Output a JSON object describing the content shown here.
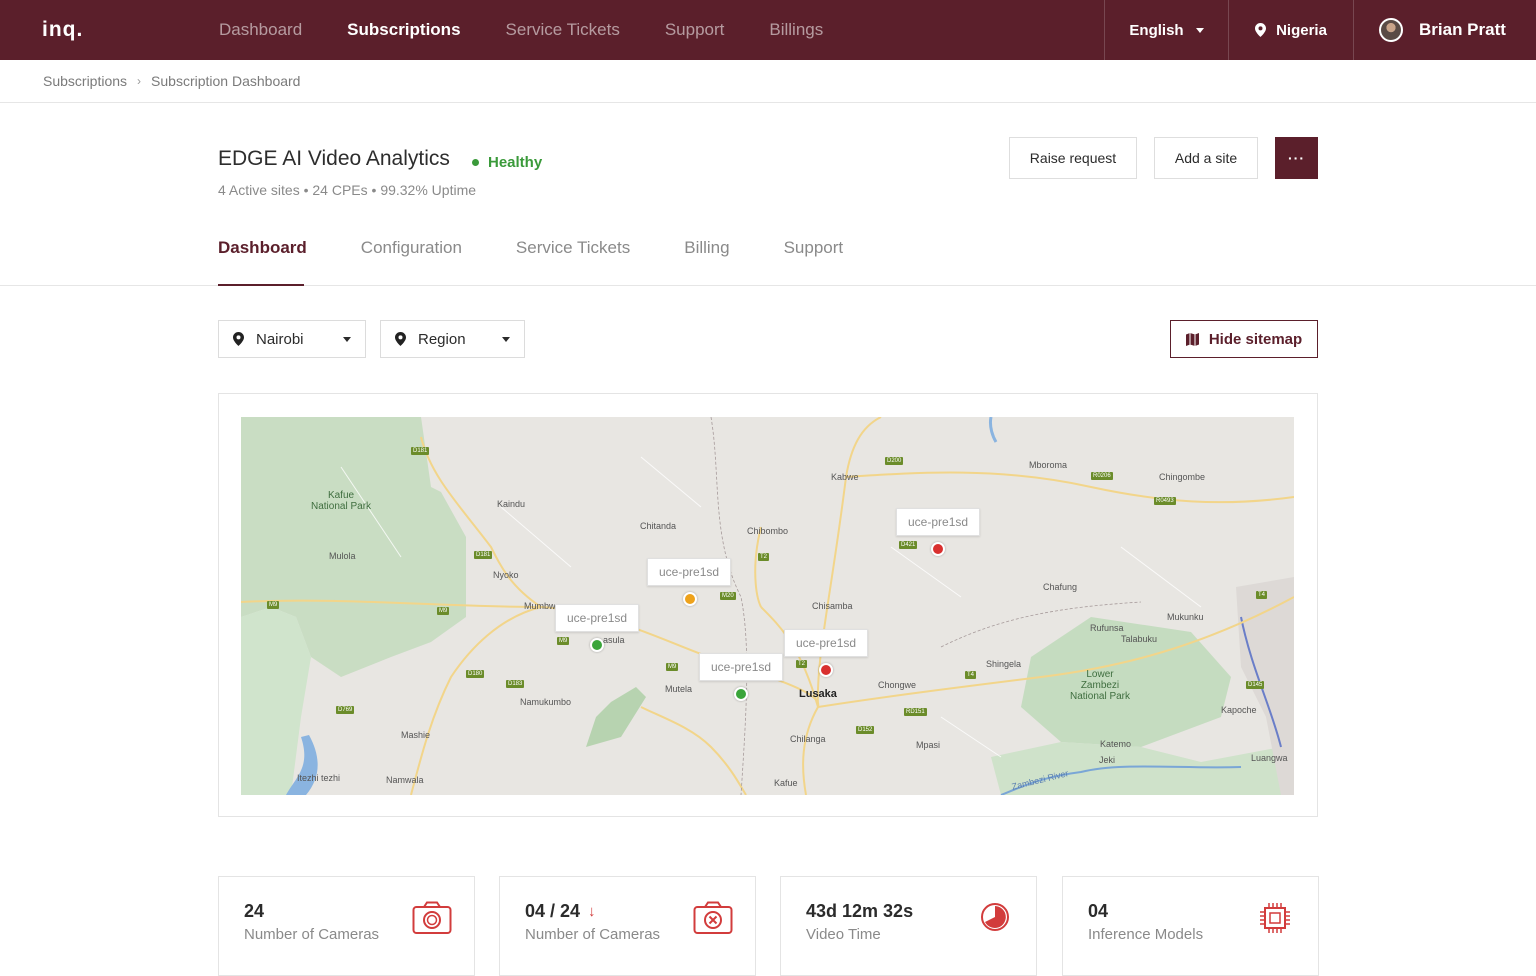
{
  "topbar": {
    "logo": "inq.",
    "nav": [
      "Dashboard",
      "Subscriptions",
      "Service Tickets",
      "Support",
      "Billings"
    ],
    "active_nav": "Subscriptions",
    "language": "English",
    "country": "Nigeria",
    "user_name": "Brian Pratt"
  },
  "breadcrumb": {
    "parent": "Subscriptions",
    "current": "Subscription Dashboard"
  },
  "header": {
    "title": "EDGE AI Video Analytics",
    "status": "Healthy",
    "summary": "4 Active sites • 24 CPEs • 99.32% Uptime",
    "raise_request": "Raise request",
    "add_site": "Add a site",
    "more": "···"
  },
  "tabs": [
    "Dashboard",
    "Configuration",
    "Service Tickets",
    "Billing",
    "Support"
  ],
  "filters": {
    "city": "Nairobi",
    "region": "Region",
    "hide_sitemap": "Hide sitemap"
  },
  "map": {
    "places": [
      "Kafue National Park",
      "Kaindu",
      "Kabwe",
      "Mboroma",
      "Chingombe",
      "Chitanda",
      "Chibombo",
      "Mulola",
      "Nyoko",
      "Mumbwa",
      "Chafung",
      "Chisamba",
      "Mukunku",
      "Rufunsa",
      "Talabuku",
      "Shingela",
      "Mutela",
      "Namukumbo",
      "Lusaka",
      "Chongwe",
      "Lower Zambezi National Park",
      "Mashie",
      "Chilanga",
      "Mpasi",
      "Kapoche",
      "Katemo",
      "Jeki",
      "Luangwa",
      "Itezhi tezhi",
      "Namwala",
      "Kafue",
      "Zambezi River",
      "asula"
    ],
    "sites": [
      {
        "label": "uce-pre1sd",
        "status": "red"
      },
      {
        "label": "uce-pre1sd",
        "status": "orange"
      },
      {
        "label": "uce-pre1sd",
        "status": "green"
      },
      {
        "label": "uce-pre1sd",
        "status": "red"
      },
      {
        "label": "uce-pre1sd",
        "status": "green"
      }
    ],
    "status_colors": {
      "red": "#d9302f",
      "orange": "#eea21b",
      "green": "#3aa53a"
    }
  },
  "stats": [
    {
      "value": "24",
      "label": "Number of Cameras",
      "icon": "camera-icon"
    },
    {
      "value": "04 / 24",
      "label": "Number of Cameras",
      "icon": "camera-off-icon",
      "trend": "down"
    },
    {
      "value": "43d 12m 32s",
      "label": "Video Time",
      "icon": "clock-pie-icon"
    },
    {
      "value": "04",
      "label": "Inference Models",
      "icon": "chip-icon"
    }
  ],
  "colors": {
    "brand": "#5b1f2b",
    "healthy": "#3a9a3a",
    "accent_red": "#d23c3c"
  }
}
